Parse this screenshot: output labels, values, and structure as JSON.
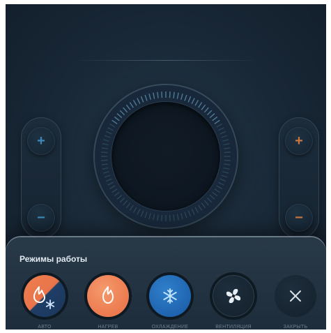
{
  "controls": {
    "left": {
      "increase_label": "+",
      "decrease_label": "−",
      "color": "#3e88b8"
    },
    "right": {
      "increase_label": "+",
      "decrease_label": "−",
      "color": "#c9773f"
    }
  },
  "modes_sheet": {
    "title": "Режимы работы",
    "modes": [
      {
        "label": "АВТО",
        "icon": "auto-icon"
      },
      {
        "label": "НАГРЕВ",
        "icon": "flame-icon"
      },
      {
        "label": "ОХЛАЖДЕНИЕ",
        "icon": "snowflake-icon"
      },
      {
        "label": "ВЕНТИЛЯЦИЯ",
        "icon": "fan-icon"
      },
      {
        "label": "ЗАКРЫТЬ",
        "icon": "close-icon"
      }
    ]
  },
  "colors": {
    "heat": "#ec7a4f",
    "cool": "#1e62ad",
    "background": "#1a2a39"
  }
}
